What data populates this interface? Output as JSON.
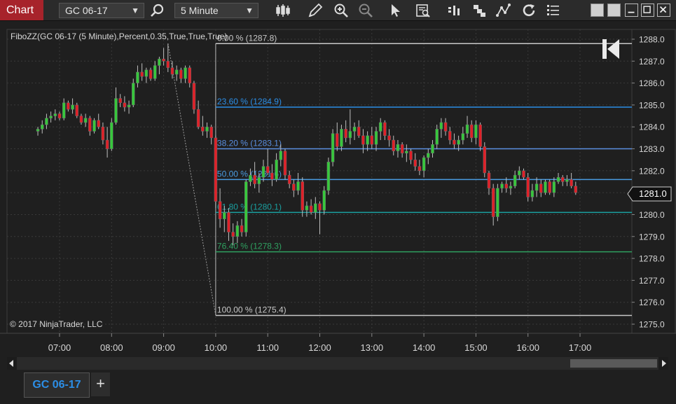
{
  "toolbar": {
    "chart_label": "Chart",
    "instrument": "GC 06-17",
    "interval": "5 Minute"
  },
  "chart": {
    "indicator_label": "FiboZZ(GC 06-17 (5 Minute),Percent,0.35,True,True,True)",
    "copyright": "© 2017 NinjaTrader, LLC",
    "current_price_label": "1281.0",
    "colors": {
      "background": "#1f1f1f",
      "up": "#37c83c",
      "down": "#e02028",
      "grid": "#3a3a3a",
      "text": "#d8d8d8"
    }
  },
  "tabs": [
    {
      "label": "GC 06-17"
    }
  ],
  "chart_data": {
    "type": "candlestick",
    "x_tick_labels": [
      "07:00",
      "08:00",
      "09:00",
      "10:00",
      "11:00",
      "12:00",
      "13:00",
      "14:00",
      "15:00",
      "16:00",
      "17:00"
    ],
    "y_tick_labels": [
      "1288.0",
      "1287.0",
      "1286.0",
      "1285.0",
      "1284.0",
      "1283.0",
      "1282.0",
      "1281.0",
      "1280.0",
      "1279.0",
      "1278.0",
      "1277.0",
      "1276.0",
      "1275.0"
    ],
    "ylim": [
      1275.0,
      1288.0
    ],
    "fib_levels": [
      {
        "label": "0.00 % (1287.8)",
        "price": 1287.8,
        "color": "#c8c8c8"
      },
      {
        "label": "23.60 % (1284.9)",
        "price": 1284.9,
        "color": "#2c8ee6"
      },
      {
        "label": "38.20 % (1283.1)",
        "price": 1283.0,
        "color": "#5a8fe0"
      },
      {
        "label": "50.00 % (1281.6)",
        "price": 1281.6,
        "color": "#4a9be0"
      },
      {
        "label": "61.80 % (1280.1)",
        "price": 1280.1,
        "color": "#1aa0a0"
      },
      {
        "label": "76.40 % (1278.3)",
        "price": 1278.3,
        "color": "#2fa060"
      },
      {
        "label": "100.00 % (1275.4)",
        "price": 1275.4,
        "color": "#c8c8c8"
      }
    ],
    "zigzag": [
      {
        "time": "09:05",
        "price": 1287.8
      },
      {
        "time": "10:00",
        "price": 1275.4
      }
    ],
    "candles": [
      {
        "t": "06:35",
        "o": 1283.8,
        "h": 1284.0,
        "l": 1283.6,
        "c": 1283.9
      },
      {
        "t": "06:40",
        "o": 1283.9,
        "h": 1284.3,
        "l": 1283.7,
        "c": 1284.1
      },
      {
        "t": "06:45",
        "o": 1284.1,
        "h": 1284.6,
        "l": 1283.9,
        "c": 1284.4
      },
      {
        "t": "06:50",
        "o": 1284.4,
        "h": 1284.7,
        "l": 1284.2,
        "c": 1284.5
      },
      {
        "t": "06:55",
        "o": 1284.5,
        "h": 1284.8,
        "l": 1284.3,
        "c": 1284.6
      },
      {
        "t": "07:00",
        "o": 1284.6,
        "h": 1284.7,
        "l": 1284.3,
        "c": 1284.4
      },
      {
        "t": "07:05",
        "o": 1284.4,
        "h": 1285.3,
        "l": 1284.3,
        "c": 1285.1
      },
      {
        "t": "07:10",
        "o": 1285.1,
        "h": 1285.2,
        "l": 1284.7,
        "c": 1284.8
      },
      {
        "t": "07:15",
        "o": 1284.8,
        "h": 1285.3,
        "l": 1284.6,
        "c": 1285.0
      },
      {
        "t": "07:20",
        "o": 1285.0,
        "h": 1285.1,
        "l": 1284.4,
        "c": 1284.5
      },
      {
        "t": "07:25",
        "o": 1284.5,
        "h": 1284.6,
        "l": 1284.1,
        "c": 1284.2
      },
      {
        "t": "07:30",
        "o": 1284.2,
        "h": 1284.6,
        "l": 1284.0,
        "c": 1284.4
      },
      {
        "t": "07:35",
        "o": 1284.4,
        "h": 1284.5,
        "l": 1283.6,
        "c": 1283.8
      },
      {
        "t": "07:40",
        "o": 1283.8,
        "h": 1284.4,
        "l": 1283.7,
        "c": 1284.3
      },
      {
        "t": "07:45",
        "o": 1284.3,
        "h": 1284.6,
        "l": 1283.9,
        "c": 1284.0
      },
      {
        "t": "07:50",
        "o": 1284.0,
        "h": 1284.2,
        "l": 1283.2,
        "c": 1283.4
      },
      {
        "t": "07:55",
        "o": 1283.4,
        "h": 1284.0,
        "l": 1282.6,
        "c": 1283.0
      },
      {
        "t": "08:00",
        "o": 1283.0,
        "h": 1284.4,
        "l": 1282.9,
        "c": 1284.2
      },
      {
        "t": "08:05",
        "o": 1284.2,
        "h": 1285.8,
        "l": 1284.1,
        "c": 1285.3
      },
      {
        "t": "08:10",
        "o": 1285.3,
        "h": 1285.5,
        "l": 1284.9,
        "c": 1285.1
      },
      {
        "t": "08:15",
        "o": 1285.1,
        "h": 1285.4,
        "l": 1284.7,
        "c": 1284.9
      },
      {
        "t": "08:20",
        "o": 1284.9,
        "h": 1285.2,
        "l": 1284.6,
        "c": 1285.0
      },
      {
        "t": "08:25",
        "o": 1285.0,
        "h": 1286.2,
        "l": 1284.9,
        "c": 1286.0
      },
      {
        "t": "08:30",
        "o": 1286.0,
        "h": 1286.8,
        "l": 1285.8,
        "c": 1286.5
      },
      {
        "t": "08:35",
        "o": 1286.5,
        "h": 1286.9,
        "l": 1286.1,
        "c": 1286.3
      },
      {
        "t": "08:40",
        "o": 1286.3,
        "h": 1286.7,
        "l": 1286.0,
        "c": 1286.6
      },
      {
        "t": "08:45",
        "o": 1286.6,
        "h": 1286.7,
        "l": 1286.1,
        "c": 1286.2
      },
      {
        "t": "08:50",
        "o": 1286.2,
        "h": 1287.0,
        "l": 1286.1,
        "c": 1286.8
      },
      {
        "t": "08:55",
        "o": 1286.8,
        "h": 1287.2,
        "l": 1286.4,
        "c": 1287.1
      },
      {
        "t": "09:00",
        "o": 1287.1,
        "h": 1287.6,
        "l": 1286.8,
        "c": 1287.0
      },
      {
        "t": "09:05",
        "o": 1287.0,
        "h": 1287.8,
        "l": 1286.5,
        "c": 1286.7
      },
      {
        "t": "09:10",
        "o": 1286.7,
        "h": 1287.0,
        "l": 1286.2,
        "c": 1286.4
      },
      {
        "t": "09:15",
        "o": 1286.4,
        "h": 1286.8,
        "l": 1286.1,
        "c": 1286.6
      },
      {
        "t": "09:20",
        "o": 1286.6,
        "h": 1286.7,
        "l": 1286.0,
        "c": 1286.2
      },
      {
        "t": "09:25",
        "o": 1286.2,
        "h": 1286.8,
        "l": 1286.0,
        "c": 1286.7
      },
      {
        "t": "09:30",
        "o": 1286.7,
        "h": 1286.8,
        "l": 1285.8,
        "c": 1286.0
      },
      {
        "t": "09:35",
        "o": 1286.0,
        "h": 1286.1,
        "l": 1284.6,
        "c": 1284.8
      },
      {
        "t": "09:40",
        "o": 1284.8,
        "h": 1285.2,
        "l": 1283.9,
        "c": 1284.0
      },
      {
        "t": "09:45",
        "o": 1284.0,
        "h": 1284.5,
        "l": 1283.6,
        "c": 1283.8
      },
      {
        "t": "09:50",
        "o": 1283.8,
        "h": 1284.2,
        "l": 1283.5,
        "c": 1284.0
      },
      {
        "t": "09:55",
        "o": 1284.0,
        "h": 1284.1,
        "l": 1283.2,
        "c": 1283.5
      },
      {
        "t": "10:00",
        "o": 1283.5,
        "h": 1283.6,
        "l": 1280.3,
        "c": 1280.6
      },
      {
        "t": "10:05",
        "o": 1280.6,
        "h": 1281.2,
        "l": 1279.4,
        "c": 1279.8
      },
      {
        "t": "10:10",
        "o": 1279.8,
        "h": 1280.4,
        "l": 1279.2,
        "c": 1280.1
      },
      {
        "t": "10:15",
        "o": 1280.1,
        "h": 1280.3,
        "l": 1278.8,
        "c": 1279.2
      },
      {
        "t": "10:20",
        "o": 1279.2,
        "h": 1279.6,
        "l": 1278.6,
        "c": 1279.0
      },
      {
        "t": "10:25",
        "o": 1279.0,
        "h": 1279.7,
        "l": 1278.7,
        "c": 1279.5
      },
      {
        "t": "10:30",
        "o": 1279.5,
        "h": 1279.8,
        "l": 1279.0,
        "c": 1279.2
      },
      {
        "t": "10:35",
        "o": 1279.2,
        "h": 1281.6,
        "l": 1279.0,
        "c": 1281.5
      },
      {
        "t": "10:40",
        "o": 1281.5,
        "h": 1282.1,
        "l": 1281.3,
        "c": 1281.8
      },
      {
        "t": "10:45",
        "o": 1281.8,
        "h": 1282.4,
        "l": 1281.2,
        "c": 1281.4
      },
      {
        "t": "10:50",
        "o": 1281.4,
        "h": 1281.9,
        "l": 1281.0,
        "c": 1281.7
      },
      {
        "t": "10:55",
        "o": 1281.7,
        "h": 1282.5,
        "l": 1281.5,
        "c": 1282.2
      },
      {
        "t": "11:00",
        "o": 1282.2,
        "h": 1283.0,
        "l": 1281.8,
        "c": 1281.9
      },
      {
        "t": "11:05",
        "o": 1281.9,
        "h": 1282.3,
        "l": 1281.3,
        "c": 1281.6
      },
      {
        "t": "11:10",
        "o": 1281.6,
        "h": 1282.8,
        "l": 1281.5,
        "c": 1282.5
      },
      {
        "t": "11:15",
        "o": 1282.5,
        "h": 1283.2,
        "l": 1282.2,
        "c": 1282.9
      },
      {
        "t": "11:20",
        "o": 1282.9,
        "h": 1283.0,
        "l": 1281.6,
        "c": 1281.8
      },
      {
        "t": "11:25",
        "o": 1281.8,
        "h": 1282.0,
        "l": 1281.2,
        "c": 1281.4
      },
      {
        "t": "11:30",
        "o": 1281.4,
        "h": 1281.6,
        "l": 1280.8,
        "c": 1281.1
      },
      {
        "t": "11:35",
        "o": 1281.1,
        "h": 1281.9,
        "l": 1280.9,
        "c": 1281.5
      },
      {
        "t": "11:40",
        "o": 1281.5,
        "h": 1281.7,
        "l": 1279.9,
        "c": 1280.2
      },
      {
        "t": "11:45",
        "o": 1280.2,
        "h": 1280.6,
        "l": 1279.9,
        "c": 1280.4
      },
      {
        "t": "11:50",
        "o": 1280.4,
        "h": 1280.7,
        "l": 1280.0,
        "c": 1280.1
      },
      {
        "t": "11:55",
        "o": 1280.1,
        "h": 1280.8,
        "l": 1279.8,
        "c": 1280.5
      },
      {
        "t": "12:00",
        "o": 1280.5,
        "h": 1280.6,
        "l": 1279.1,
        "c": 1280.2
      },
      {
        "t": "12:05",
        "o": 1280.2,
        "h": 1281.3,
        "l": 1280.0,
        "c": 1281.1
      },
      {
        "t": "12:10",
        "o": 1281.1,
        "h": 1282.6,
        "l": 1280.9,
        "c": 1282.4
      },
      {
        "t": "12:15",
        "o": 1282.4,
        "h": 1283.9,
        "l": 1282.2,
        "c": 1283.7
      },
      {
        "t": "12:20",
        "o": 1283.7,
        "h": 1284.2,
        "l": 1282.9,
        "c": 1283.1
      },
      {
        "t": "12:25",
        "o": 1283.1,
        "h": 1284.1,
        "l": 1282.9,
        "c": 1283.9
      },
      {
        "t": "12:30",
        "o": 1283.9,
        "h": 1284.3,
        "l": 1283.3,
        "c": 1283.5
      },
      {
        "t": "12:35",
        "o": 1283.5,
        "h": 1284.8,
        "l": 1283.2,
        "c": 1283.8
      },
      {
        "t": "12:40",
        "o": 1283.8,
        "h": 1284.2,
        "l": 1283.4,
        "c": 1284.0
      },
      {
        "t": "12:45",
        "o": 1284.0,
        "h": 1284.3,
        "l": 1283.5,
        "c": 1283.6
      },
      {
        "t": "12:50",
        "o": 1283.6,
        "h": 1283.9,
        "l": 1282.8,
        "c": 1283.2
      },
      {
        "t": "12:55",
        "o": 1283.2,
        "h": 1283.8,
        "l": 1282.9,
        "c": 1283.6
      },
      {
        "t": "13:00",
        "o": 1283.6,
        "h": 1284.0,
        "l": 1283.0,
        "c": 1283.2
      },
      {
        "t": "13:05",
        "o": 1283.2,
        "h": 1284.0,
        "l": 1282.9,
        "c": 1283.8
      },
      {
        "t": "13:10",
        "o": 1283.8,
        "h": 1284.4,
        "l": 1283.4,
        "c": 1284.2
      },
      {
        "t": "13:15",
        "o": 1284.2,
        "h": 1284.3,
        "l": 1283.4,
        "c": 1283.6
      },
      {
        "t": "13:20",
        "o": 1283.6,
        "h": 1283.9,
        "l": 1283.1,
        "c": 1283.4
      },
      {
        "t": "13:25",
        "o": 1283.4,
        "h": 1283.6,
        "l": 1282.7,
        "c": 1282.9
      },
      {
        "t": "13:30",
        "o": 1282.9,
        "h": 1283.4,
        "l": 1282.6,
        "c": 1283.2
      },
      {
        "t": "13:35",
        "o": 1283.2,
        "h": 1283.3,
        "l": 1282.6,
        "c": 1282.8
      },
      {
        "t": "13:40",
        "o": 1282.8,
        "h": 1283.2,
        "l": 1282.4,
        "c": 1282.9
      },
      {
        "t": "13:45",
        "o": 1282.9,
        "h": 1283.0,
        "l": 1282.3,
        "c": 1282.5
      },
      {
        "t": "13:50",
        "o": 1282.5,
        "h": 1282.8,
        "l": 1282.0,
        "c": 1282.2
      },
      {
        "t": "13:55",
        "o": 1282.2,
        "h": 1282.5,
        "l": 1281.8,
        "c": 1282.0
      },
      {
        "t": "14:00",
        "o": 1282.0,
        "h": 1282.7,
        "l": 1281.7,
        "c": 1282.6
      },
      {
        "t": "14:05",
        "o": 1282.6,
        "h": 1283.0,
        "l": 1282.3,
        "c": 1282.8
      },
      {
        "t": "14:10",
        "o": 1282.8,
        "h": 1283.4,
        "l": 1282.6,
        "c": 1283.2
      },
      {
        "t": "14:15",
        "o": 1283.2,
        "h": 1284.1,
        "l": 1283.0,
        "c": 1283.9
      },
      {
        "t": "14:20",
        "o": 1283.9,
        "h": 1284.4,
        "l": 1283.5,
        "c": 1284.2
      },
      {
        "t": "14:25",
        "o": 1284.2,
        "h": 1284.4,
        "l": 1283.6,
        "c": 1283.8
      },
      {
        "t": "14:30",
        "o": 1283.8,
        "h": 1284.0,
        "l": 1283.2,
        "c": 1283.4
      },
      {
        "t": "14:35",
        "o": 1283.4,
        "h": 1283.7,
        "l": 1283.0,
        "c": 1283.2
      },
      {
        "t": "14:40",
        "o": 1283.2,
        "h": 1283.6,
        "l": 1282.9,
        "c": 1283.4
      },
      {
        "t": "14:45",
        "o": 1283.4,
        "h": 1284.0,
        "l": 1283.2,
        "c": 1283.7
      },
      {
        "t": "14:50",
        "o": 1283.7,
        "h": 1284.5,
        "l": 1283.5,
        "c": 1284.1
      },
      {
        "t": "14:55",
        "o": 1284.1,
        "h": 1284.3,
        "l": 1283.3,
        "c": 1283.5
      },
      {
        "t": "15:00",
        "o": 1283.5,
        "h": 1284.3,
        "l": 1283.2,
        "c": 1284.1
      },
      {
        "t": "15:05",
        "o": 1284.1,
        "h": 1284.2,
        "l": 1282.9,
        "c": 1283.1
      },
      {
        "t": "15:10",
        "o": 1283.1,
        "h": 1283.3,
        "l": 1281.7,
        "c": 1281.9
      },
      {
        "t": "15:15",
        "o": 1281.9,
        "h": 1282.0,
        "l": 1280.9,
        "c": 1281.2
      },
      {
        "t": "15:20",
        "o": 1281.2,
        "h": 1281.4,
        "l": 1279.5,
        "c": 1279.9
      },
      {
        "t": "15:25",
        "o": 1279.9,
        "h": 1281.4,
        "l": 1279.7,
        "c": 1281.2
      },
      {
        "t": "15:30",
        "o": 1281.2,
        "h": 1281.5,
        "l": 1281.0,
        "c": 1281.4
      },
      {
        "t": "15:35",
        "o": 1281.4,
        "h": 1281.7,
        "l": 1281.0,
        "c": 1281.2
      },
      {
        "t": "15:40",
        "o": 1281.2,
        "h": 1281.5,
        "l": 1280.9,
        "c": 1281.3
      },
      {
        "t": "15:45",
        "o": 1281.3,
        "h": 1282.0,
        "l": 1281.2,
        "c": 1281.8
      },
      {
        "t": "15:50",
        "o": 1281.8,
        "h": 1282.2,
        "l": 1281.6,
        "c": 1282.0
      },
      {
        "t": "15:55",
        "o": 1282.0,
        "h": 1282.1,
        "l": 1281.6,
        "c": 1281.7
      },
      {
        "t": "16:00",
        "o": 1281.7,
        "h": 1281.9,
        "l": 1280.6,
        "c": 1280.8
      },
      {
        "t": "16:05",
        "o": 1280.8,
        "h": 1281.4,
        "l": 1280.6,
        "c": 1281.1
      },
      {
        "t": "16:10",
        "o": 1281.1,
        "h": 1281.7,
        "l": 1280.8,
        "c": 1281.4
      },
      {
        "t": "16:15",
        "o": 1281.4,
        "h": 1281.6,
        "l": 1280.8,
        "c": 1281.0
      },
      {
        "t": "16:20",
        "o": 1281.0,
        "h": 1281.6,
        "l": 1280.9,
        "c": 1281.5
      },
      {
        "t": "16:25",
        "o": 1281.5,
        "h": 1281.6,
        "l": 1280.9,
        "c": 1281.0
      },
      {
        "t": "16:30",
        "o": 1281.0,
        "h": 1281.7,
        "l": 1280.8,
        "c": 1281.5
      },
      {
        "t": "16:35",
        "o": 1281.5,
        "h": 1281.9,
        "l": 1281.4,
        "c": 1281.7
      },
      {
        "t": "16:40",
        "o": 1281.7,
        "h": 1281.8,
        "l": 1281.3,
        "c": 1281.5
      },
      {
        "t": "16:45",
        "o": 1281.5,
        "h": 1281.8,
        "l": 1281.3,
        "c": 1281.6
      },
      {
        "t": "16:50",
        "o": 1281.6,
        "h": 1281.9,
        "l": 1281.2,
        "c": 1281.3
      },
      {
        "t": "16:55",
        "o": 1281.3,
        "h": 1281.5,
        "l": 1280.9,
        "c": 1281.0
      }
    ]
  }
}
